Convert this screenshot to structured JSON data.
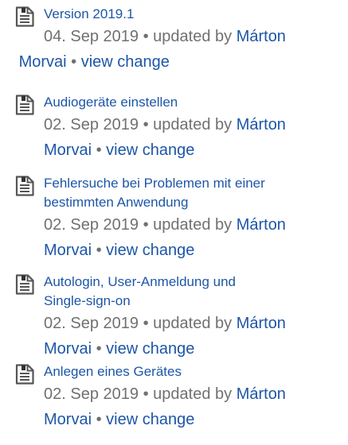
{
  "updates": [
    {
      "title": "Version 2019.1",
      "date": "04. Sep 2019",
      "bullet": "•",
      "updated_by": "updated by",
      "author_first": "Márton",
      "author_last": "Morvai",
      "link": "view change"
    },
    {
      "title": "Audiogeräte einstellen",
      "date": "02. Sep 2019",
      "bullet": "•",
      "updated_by": "updated by",
      "author_first": "Márton",
      "author_last": "Morvai",
      "link": "view change"
    },
    {
      "title_line1": "Fehlersuche bei Problemen mit einer",
      "title_line2": "bestimmten Anwendung",
      "date": "02. Sep 2019",
      "bullet": "•",
      "updated_by": "updated by",
      "author_first": "Márton",
      "author_last": "Morvai",
      "link": "view change"
    },
    {
      "title_line1": "Autologin, User-Anmeldung und",
      "title_line2": "Single-sign-on",
      "date": "02. Sep 2019",
      "bullet": "•",
      "updated_by": "updated by",
      "author_first": "Márton",
      "author_last": "Morvai",
      "link": "view change"
    },
    {
      "title": "Anlegen eines Gerätes",
      "date": "02. Sep 2019",
      "bullet": "•",
      "updated_by": "updated by",
      "author_first": "Márton",
      "author_last": "Morvai",
      "link": "view change"
    }
  ],
  "icons": {
    "page": "page-document-icon"
  },
  "colors": {
    "link": "#1d56a8",
    "meta_text": "#707070",
    "icon_stroke": "#555555"
  }
}
